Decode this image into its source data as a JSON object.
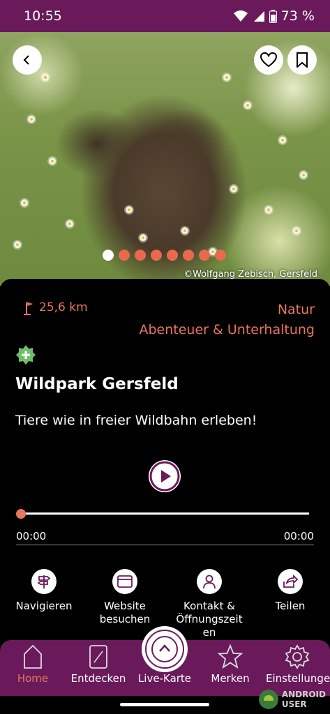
{
  "status": {
    "time": "10:55",
    "battery": "73 %"
  },
  "hero": {
    "credit": "©Wolfgang Zebisch, Gersfeld",
    "slide_count": 8,
    "active_slide": 0
  },
  "detail": {
    "distance": "25,6 km",
    "category_primary": "Natur",
    "category_secondary": "Abenteuer & Unterhaltung",
    "title": "Wildpark Gersfeld",
    "subtitle": "Tiere wie in freier Wildbahn erleben!"
  },
  "audio": {
    "elapsed": "00:00",
    "duration": "00:00",
    "progress": 0
  },
  "actions": [
    {
      "label": "Navigieren",
      "icon": "signpost-icon"
    },
    {
      "label": "Website\nbesuchen",
      "icon": "browser-icon"
    },
    {
      "label": "Kontakt &\nÖffnungszeit\nen",
      "icon": "person-icon"
    },
    {
      "label": "Teilen",
      "icon": "share-icon"
    }
  ],
  "nav": {
    "home": "Home",
    "discover": "Entdecken",
    "live": "Live-Karte",
    "saved": "Merken",
    "settings": "Einstellunge"
  },
  "watermark": {
    "line1": "ANDROID",
    "line2": "USER"
  },
  "colors": {
    "brand": "#6a1a5b",
    "accent": "#e8775c",
    "badge": "#6fbf6a"
  }
}
